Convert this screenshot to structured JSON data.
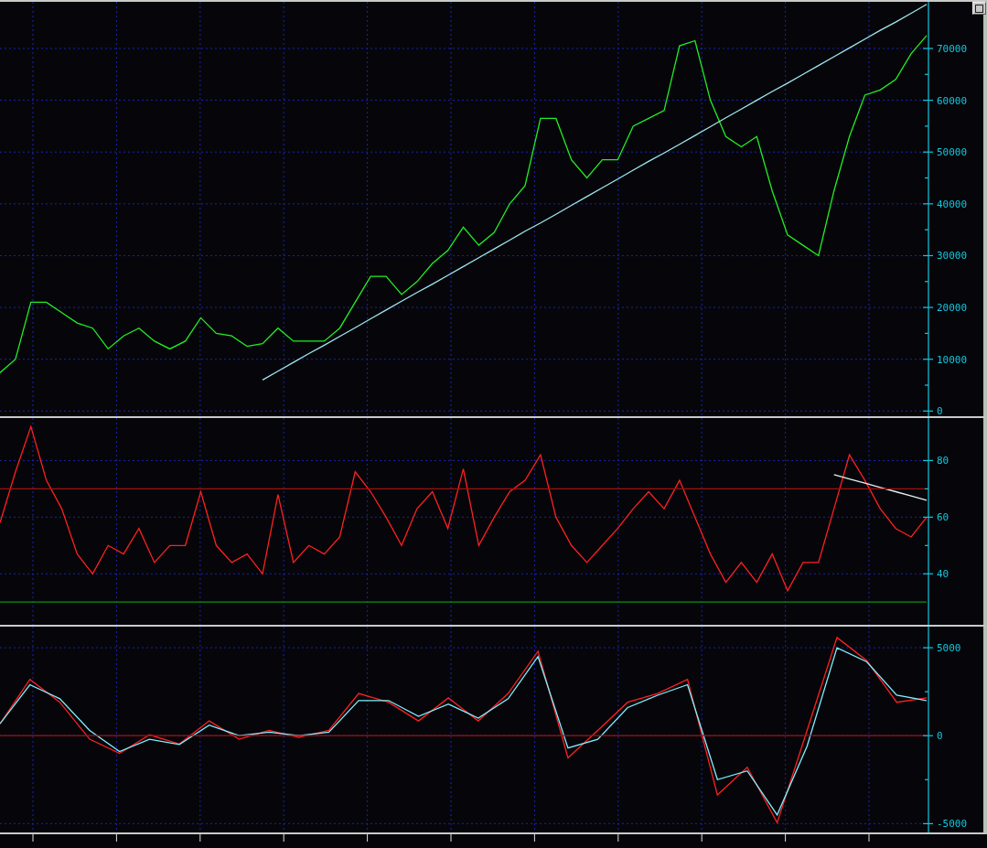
{
  "price_panel": {
    "chart_data": {
      "type": "line",
      "grid": true,
      "ylim": [
        -1000,
        79000
      ],
      "yticks": [
        0,
        10000,
        20000,
        30000,
        40000,
        50000,
        60000,
        70000
      ],
      "series": [
        {
          "color": "#22ee22",
          "values": [
            7400,
            10000,
            21000,
            21000,
            19000,
            17000,
            16000,
            12000,
            14500,
            16000,
            13500,
            12000,
            13500,
            18000,
            15000,
            14500,
            12500,
            13000,
            16000,
            13500,
            13500,
            13500,
            16000,
            21000,
            26000,
            26000,
            22500,
            25000,
            28500,
            31000,
            35500,
            32000,
            34500,
            40000,
            43500,
            56500,
            56500,
            48500,
            45000,
            48500,
            48500,
            55000,
            56500,
            58000,
            70500,
            71500,
            60000,
            53000,
            51000,
            53000,
            42500,
            34000,
            32000,
            30000,
            42500,
            53000,
            61000,
            62000,
            64000,
            69000,
            72500
          ]
        },
        {
          "color": "#9fe8f0",
          "values": [
            null,
            null,
            null,
            null,
            null,
            null,
            null,
            null,
            null,
            null,
            null,
            null,
            null,
            null,
            null,
            null,
            null,
            6000,
            7700,
            9400,
            11100,
            12700,
            14400,
            16100,
            17800,
            19500,
            21200,
            22900,
            24500,
            26200,
            27900,
            29600,
            31300,
            33000,
            34700,
            36300,
            38000,
            39700,
            41400,
            43100,
            44800,
            46500,
            48200,
            49800,
            51500,
            53200,
            54900,
            56600,
            58300,
            60000,
            61700,
            63300,
            65000,
            66700,
            68400,
            70100,
            71800,
            73500,
            75100,
            76800,
            78500
          ]
        }
      ]
    }
  },
  "rsi_panel": {
    "chart_data": {
      "type": "line",
      "grid": true,
      "ylim": [
        22,
        95
      ],
      "yticks": [
        40,
        60,
        80
      ],
      "series": [
        {
          "color": "#ff2020",
          "values": [
            58,
            76,
            92,
            73,
            63,
            47,
            40,
            50,
            47,
            56,
            44,
            50,
            50,
            69,
            50,
            44,
            47,
            40,
            68,
            44,
            50,
            47,
            53,
            76,
            69,
            60,
            50,
            63,
            69,
            56,
            77,
            50,
            60,
            69,
            73,
            82,
            60,
            50,
            44,
            50,
            56,
            63,
            69,
            63,
            73,
            60,
            47,
            37,
            44,
            37,
            47,
            34,
            44,
            44,
            63,
            82,
            73,
            63,
            56,
            53,
            60
          ]
        },
        {
          "color": "#e8f0f0",
          "values": [
            null,
            null,
            null,
            null,
            null,
            null,
            null,
            null,
            null,
            null,
            null,
            null,
            null,
            null,
            null,
            null,
            null,
            null,
            null,
            null,
            null,
            null,
            null,
            null,
            null,
            null,
            null,
            null,
            null,
            null,
            null,
            null,
            null,
            null,
            null,
            null,
            null,
            null,
            null,
            null,
            null,
            null,
            null,
            null,
            null,
            null,
            null,
            null,
            null,
            null,
            null,
            null,
            null,
            null,
            75,
            73.5,
            72,
            70.5,
            69,
            67.5,
            66
          ]
        },
        {
          "color": "#a01010",
          "values": [
            70,
            70,
            70,
            70,
            70,
            70,
            70,
            70,
            70,
            70,
            70,
            70,
            70,
            70,
            70,
            70,
            70,
            70,
            70,
            70,
            70,
            70,
            70,
            70,
            70,
            70,
            70,
            70,
            70,
            70,
            70,
            70,
            70,
            70,
            70,
            70,
            70,
            70,
            70,
            70,
            70,
            70,
            70,
            70,
            70,
            70,
            70,
            70,
            70,
            70,
            70,
            70,
            70,
            70,
            70,
            70,
            70,
            70,
            70,
            70,
            70
          ]
        },
        {
          "color": "#109010",
          "values": [
            30,
            30,
            30,
            30,
            30,
            30,
            30,
            30,
            30,
            30,
            30,
            30,
            30,
            30,
            30,
            30,
            30,
            30,
            30,
            30,
            30,
            30,
            30,
            30,
            30,
            30,
            30,
            30,
            30,
            30,
            30,
            30,
            30,
            30,
            30,
            30,
            30,
            30,
            30,
            30,
            30,
            30,
            30,
            30,
            30,
            30,
            30,
            30,
            30,
            30,
            30,
            30,
            30,
            30,
            30,
            30,
            30,
            30,
            30,
            30,
            30
          ]
        }
      ]
    }
  },
  "macd_panel": {
    "chart_data": {
      "type": "line",
      "grid": true,
      "ylim": [
        -5500,
        6200
      ],
      "yticks": [
        -5000,
        0,
        5000
      ],
      "series": [
        {
          "color": "#ff2020",
          "values": [
            680,
            3200,
            1900,
            -200,
            -1000,
            50,
            -470,
            840,
            -200,
            300,
            -100,
            300,
            2400,
            1900,
            840,
            2150,
            840,
            2400,
            4800,
            -1260,
            300,
            1900,
            2400,
            3200,
            -3370,
            -1800,
            -4950,
            300,
            5580,
            4260,
            1900,
            2150
          ]
        },
        {
          "color": "#80f0ff",
          "values": [
            680,
            2900,
            2100,
            300,
            -900,
            -200,
            -500,
            600,
            0,
            200,
            0,
            200,
            2000,
            2000,
            1100,
            1800,
            1000,
            2100,
            4500,
            -700,
            -200,
            1600,
            2300,
            2900,
            -2500,
            -2000,
            -4500,
            -600,
            5000,
            4200,
            2300,
            2000
          ]
        },
        {
          "color": "#a01010",
          "values": [
            0,
            0,
            0,
            0,
            0,
            0,
            0,
            0,
            0,
            0,
            0,
            0,
            0,
            0,
            0,
            0,
            0,
            0,
            0,
            0,
            0,
            0,
            0,
            0,
            0,
            0,
            0,
            0,
            0,
            0,
            0,
            0
          ]
        }
      ]
    }
  }
}
